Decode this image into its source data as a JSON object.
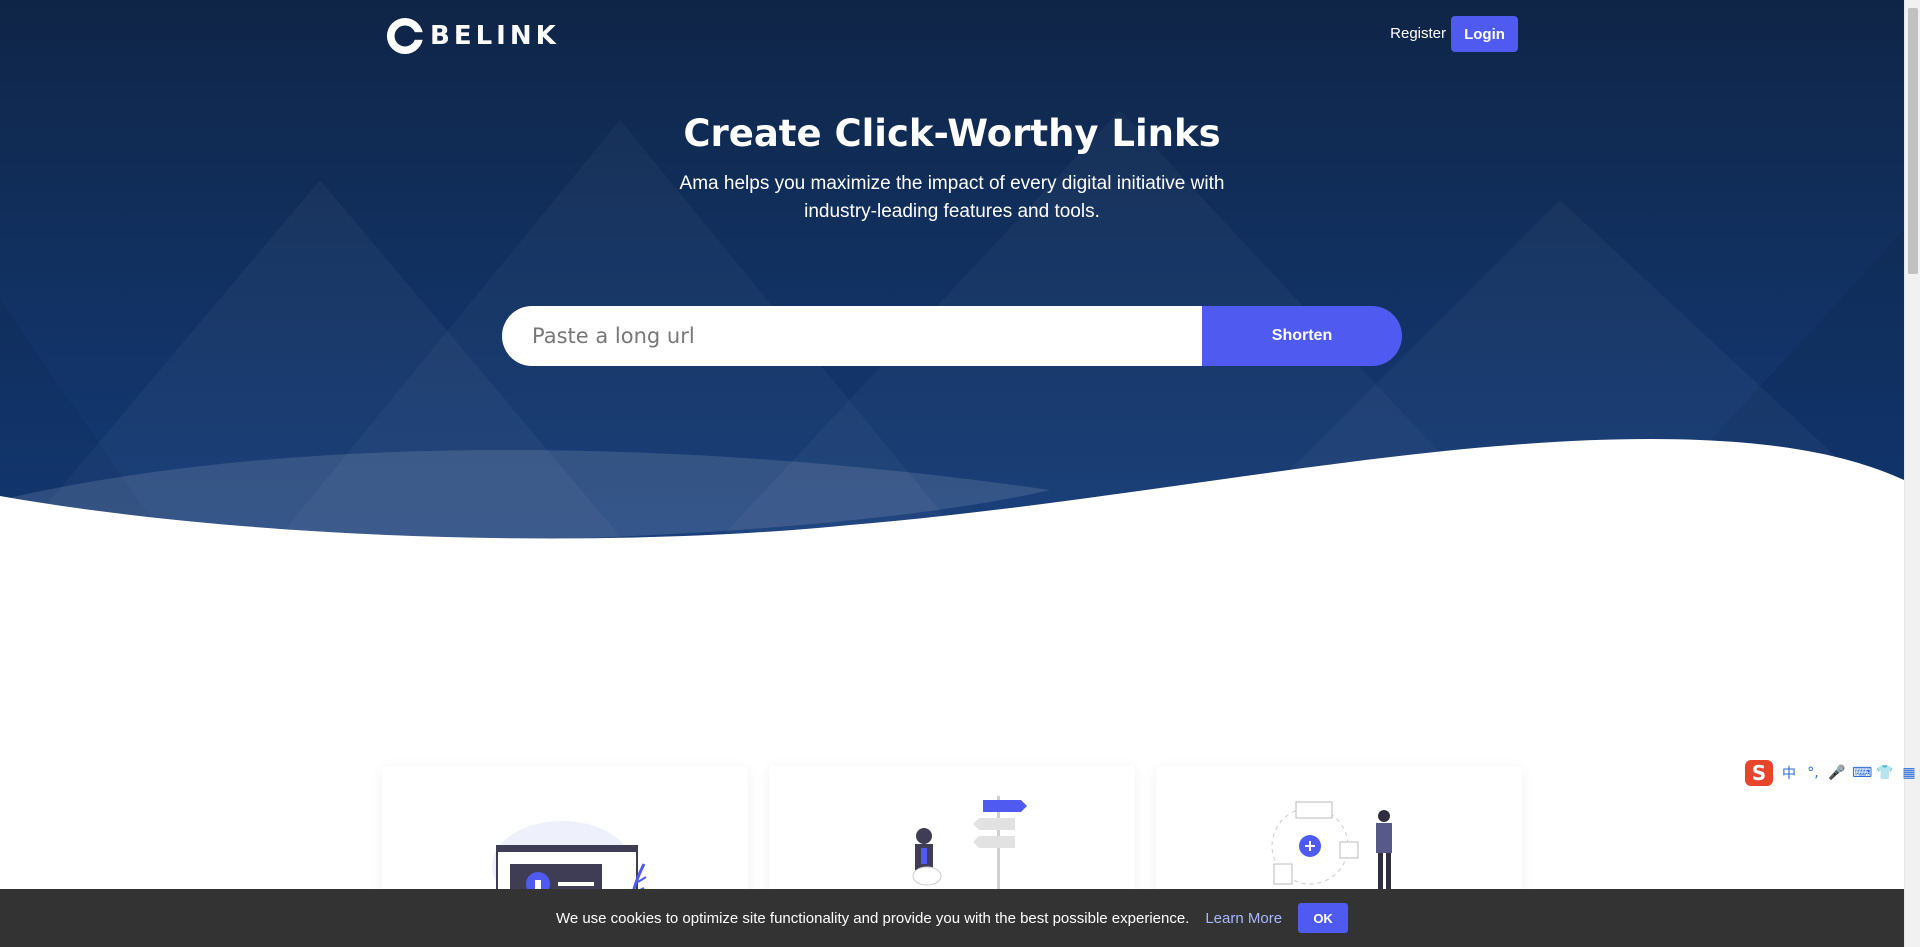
{
  "nav": {
    "logo_text": "BELINK",
    "register_label": "Register",
    "login_label": "Login"
  },
  "hero": {
    "title": "Create Click-Worthy Links",
    "subtitle": "Ama helps you maximize the impact of every digital initiative with industry-leading features and tools."
  },
  "shorten": {
    "placeholder": "Paste a long url",
    "button_label": "Shorten"
  },
  "cards": [
    {
      "icon": "security-lock-icon"
    },
    {
      "icon": "signpost-icon"
    },
    {
      "icon": "add-content-icon"
    }
  ],
  "cookie": {
    "text": "We use cookies to optimize site functionality and provide you with the best possible experience.",
    "learn_more": "Learn More",
    "ok_label": "OK"
  },
  "ime": {
    "items": [
      "中",
      "°,",
      "🎤",
      "⌨",
      "👕",
      "▦"
    ]
  },
  "colors": {
    "hero_dark": "#0f2547",
    "hero_mid": "#133a78",
    "accent": "#4f5bf0",
    "cookie_bg": "#333333"
  }
}
